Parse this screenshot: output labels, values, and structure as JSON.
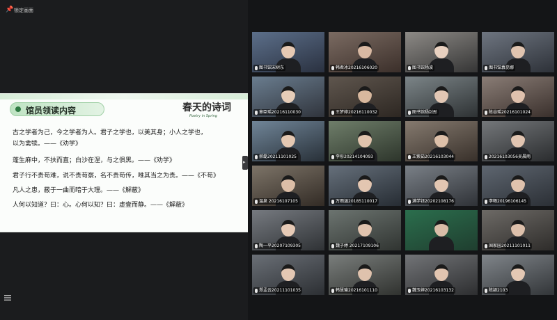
{
  "topbar": {
    "lock_label": "锁定画面"
  },
  "slide": {
    "heading": "馆员领读内容",
    "logo_cn": "春天的诗词",
    "logo_en": "Poetry in Spring",
    "lines": [
      "古之学者为己，今之学者为人。君子之学也，以美其身；小人之学也，",
      "以为禽犊。——《劝学》",
      "蓬生麻中，不扶而直；白沙在涅，与之俱黑。——《劝学》",
      "君子行不贵苟难，说不贵苟察，名不贵苟传，唯其当之为贵。——《不苟》",
      "凡人之患，蔽于一曲而暗于大理。——《解蔽》",
      "人何以知道？曰：心。心何以知？曰：虚壹而静。——《解蔽》"
    ]
  },
  "participants": [
    "图书馆宋树东",
    "韩君冰20216106020",
    "图书馆杨波",
    "图书馆袁蕊娜",
    "章臣瑶20216110030",
    "王梦婷20216110032",
    "图书馆杨封彤",
    "陈谷瑶20216101024",
    "郝磊20211101025",
    "李彤20214104093",
    "王紫茹20216103044",
    "20216103056吴晨雨",
    "温泉 20216107105",
    "万雨涵20185110017",
    "满学钰20202108176",
    "李畅20196106145",
    "陶一平20207109305",
    "魏子婷 20217109106",
    "",
    "国家园20211101011",
    "郑孟云20211101035",
    "韩慧瑜20216101110",
    "魏玉婷20216103132",
    "陈颖2103"
  ],
  "accent_colors": {
    "slide_green": "#2f7a43",
    "grid_bg": "#141517"
  }
}
